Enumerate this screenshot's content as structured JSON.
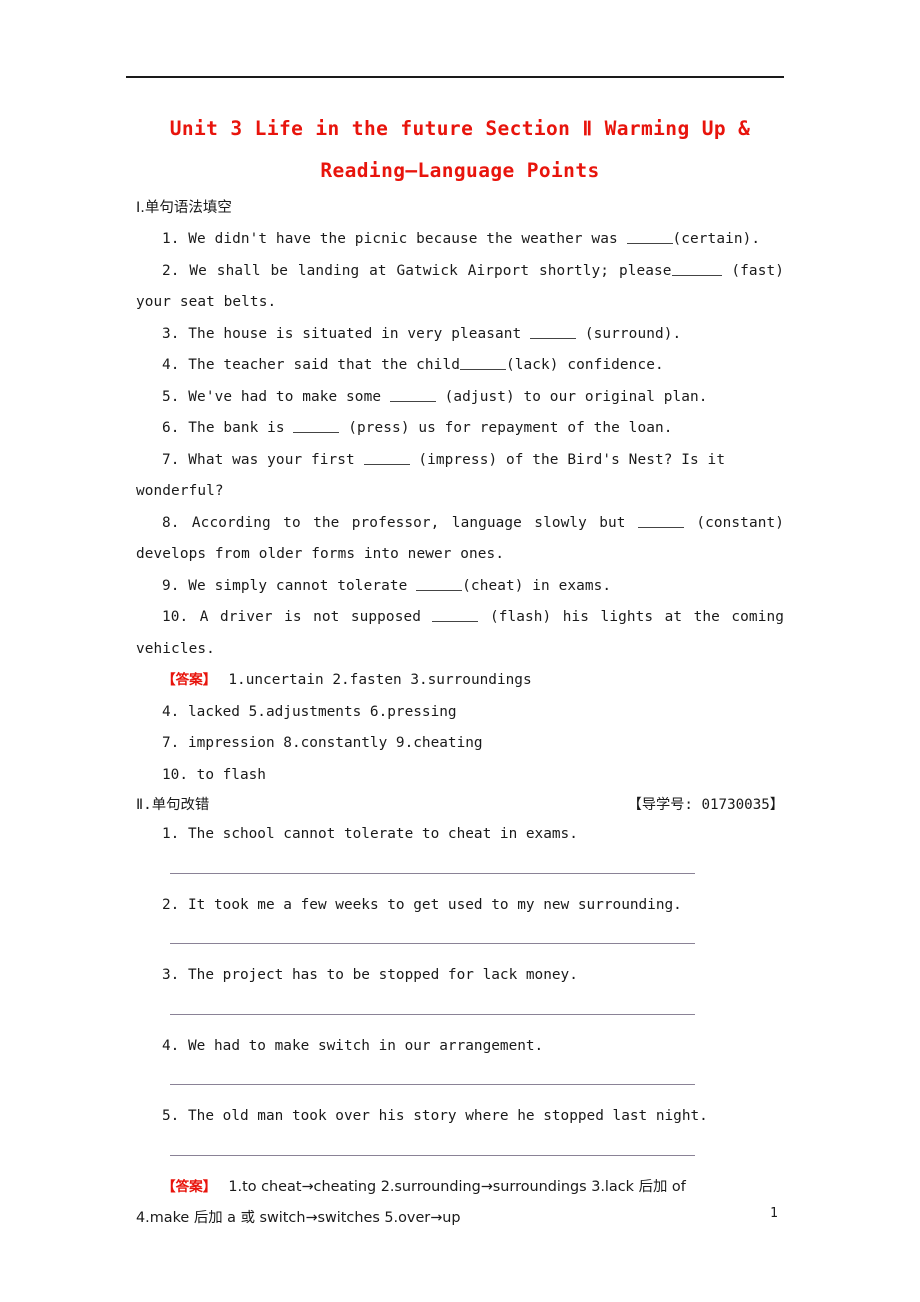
{
  "document": {
    "title_line1": "Unit 3 Life in the future Section Ⅱ Warming Up &",
    "title_line2": "Reading—Language Points",
    "title_color": "#e8140c",
    "page_number": "1"
  },
  "section1": {
    "heading": "Ⅰ.单句语法填空",
    "questions": [
      {
        "num": "1.",
        "before": "We didn't have the picnic because the weather was ",
        "blank": true,
        "after": "(certain)."
      },
      {
        "num": "2.",
        "before": "We shall be landing at Gatwick Airport shortly; please",
        "blank": true,
        "after": " (fast) your seat belts."
      },
      {
        "num": "3.",
        "before": "The house is situated in very pleasant ",
        "blank": true,
        "after": " (surround)."
      },
      {
        "num": "4.",
        "before": "The teacher said that the child",
        "blank": true,
        "after": "(lack) confidence."
      },
      {
        "num": "5.",
        "before": "We've had to make some ",
        "blank": true,
        "after": " (adjust) to our original plan."
      },
      {
        "num": "6.",
        "before": "The bank is ",
        "blank": true,
        "after": " (press) us for repayment of the loan."
      },
      {
        "num": "7.",
        "before": "What was your first ",
        "blank": true,
        "after": " (impress) of the Bird's Nest? Is it wonderful?"
      },
      {
        "num": "8.",
        "before": "According to the professor, language slowly but ",
        "blank": true,
        "after": " (constant) develops from older forms into newer ones."
      },
      {
        "num": "9.",
        "before": "We simply cannot tolerate ",
        "blank": true,
        "after": "(cheat) in exams."
      },
      {
        "num": "10.",
        "before": "A driver is not supposed ",
        "blank": true,
        "after": " (flash) his lights at the coming vehicles."
      }
    ],
    "answer_tag": "【答案】",
    "answer_lines": [
      "1.uncertain  2.fasten  3.surroundings",
      "4. lacked  5.adjustments  6.pressing",
      "7. impression  8.constantly  9.cheating",
      "10. to flash"
    ]
  },
  "section2": {
    "heading": "Ⅱ.单句改错",
    "guide_number_label": "【导学号: 01730035】",
    "items": [
      {
        "num": "1.",
        "text": "The school cannot tolerate to cheat in exams."
      },
      {
        "num": "2.",
        "text": "It took me a few weeks to get used to my new surrounding."
      },
      {
        "num": "3.",
        "text": "The project has to be stopped for lack money."
      },
      {
        "num": "4.",
        "text": "We had to make switch in our arrangement."
      },
      {
        "num": "5.",
        "text": "The old man took over his story where he stopped last night."
      }
    ],
    "answer_tag": "【答案】",
    "answer_line1": "1.to cheat→cheating   2.surrounding→surroundings   3.lack 后加 of",
    "answer_line2": "4.make 后加 a 或 switch→switches   5.over→up"
  }
}
